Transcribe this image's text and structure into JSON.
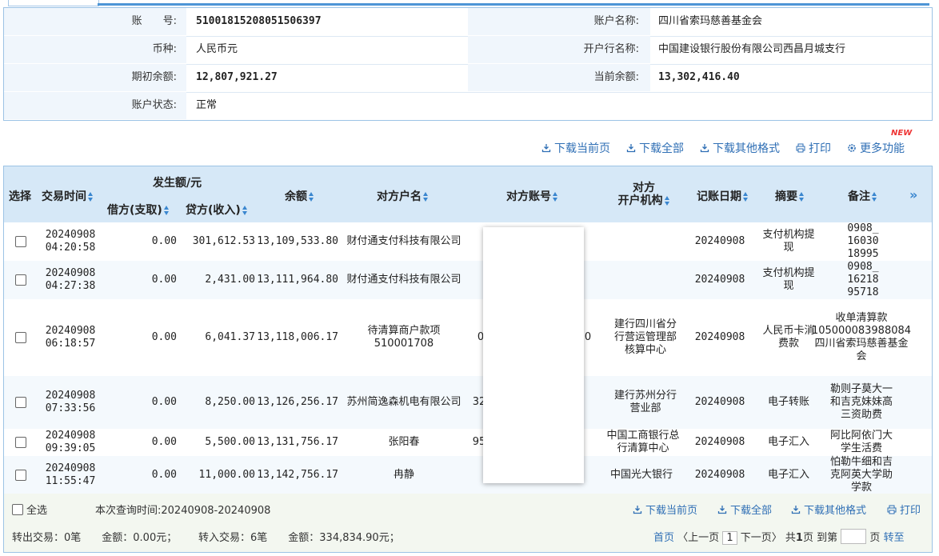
{
  "account": {
    "acct_no_label": "账　　号:",
    "acct_no": "51001815208051506397",
    "acct_name_label": "账户名称:",
    "acct_name": "四川省索玛慈善基金会",
    "currency_label": "币种:",
    "currency": "人民币元",
    "bank_label": "开户行名称:",
    "bank": "中国建设银行股份有限公司西昌月城支行",
    "opening_balance_label": "期初余额:",
    "opening_balance": "12,807,921.27",
    "current_balance_label": "当前余额:",
    "current_balance": "13,302,416.40",
    "status_label": "账户状态:",
    "status": "正常"
  },
  "toolbar": {
    "badge": "NEW",
    "items": [
      {
        "label": "下载当前页",
        "icon": "download-icon"
      },
      {
        "label": "下载全部",
        "icon": "download-icon"
      },
      {
        "label": "下载其他格式",
        "icon": "download-icon"
      },
      {
        "label": "打印",
        "icon": "print-icon"
      },
      {
        "label": "更多功能",
        "icon": "gear-icon"
      }
    ]
  },
  "table": {
    "headers": {
      "select": "选择",
      "time": "交易时间",
      "amount_group": "发生额/元",
      "debit": "借方(支取)",
      "credit": "贷方(收入)",
      "balance": "余额",
      "cp_name": "对方户名",
      "cp_acct": "对方账号",
      "cp_bank": "对方\n开户机构",
      "post_date": "记账日期",
      "summary": "摘要",
      "remark": "备注",
      "more": "»"
    },
    "rows": [
      {
        "date": "20240908",
        "time": "04:20:58",
        "debit": "0.00",
        "credit": "301,612.53",
        "balance": "13,109,533.80",
        "cp_name": "财付通支付科技有限公司",
        "cp_acct": "",
        "cp_bank": "",
        "post_date": "20240908",
        "summary": "支付机构提现",
        "remark": "0908_1603018995"
      },
      {
        "date": "20240908",
        "time": "04:27:38",
        "debit": "0.00",
        "credit": "2,431.00",
        "balance": "13,111,964.80",
        "cp_name": "财付通支付科技有限公司",
        "cp_acct": "",
        "cp_bank": "",
        "post_date": "20240908",
        "summary": "支付机构提现",
        "remark": "0908_1621895718"
      },
      {
        "date": "20240908",
        "time": "06:18:57",
        "debit": "0.00",
        "credit": "6,041.37",
        "balance": "13,118,006.17",
        "cp_name": "待清算商户款项510001708",
        "cp_acct": "0",
        "cp_acct_tail": "0",
        "cp_bank": "建行四川省分行营运管理部核算中心",
        "post_date": "20240908",
        "summary": "人民币卡消费款",
        "remark": "收单清算款105000083988084四川省索玛慈善基金会"
      },
      {
        "date": "20240908",
        "time": "07:33:56",
        "debit": "0.00",
        "credit": "8,250.00",
        "balance": "13,126,256.17",
        "cp_name": "苏州简逸森机电有限公司",
        "cp_acct": "32",
        "cp_bank": "建行苏州分行营业部",
        "post_date": "20240908",
        "summary": "电子转账",
        "remark": "勒则子莫大一和吉克妹妹高三资助费"
      },
      {
        "date": "20240908",
        "time": "09:39:05",
        "debit": "0.00",
        "credit": "5,500.00",
        "balance": "13,131,756.17",
        "cp_name": "张阳春",
        "cp_acct": "95",
        "cp_bank": "中国工商银行总行清算中心",
        "post_date": "20240908",
        "summary": "电子汇入",
        "remark": "阿比阿依门大学生活费"
      },
      {
        "date": "20240908",
        "time": "11:55:47",
        "debit": "0.00",
        "credit": "11,000.00",
        "balance": "13,142,756.17",
        "cp_name": "冉静",
        "cp_acct": "",
        "cp_bank": "中国光大银行",
        "post_date": "20240908",
        "summary": "电子汇入",
        "remark": "怕勒牛细和吉克阿英大学助学款"
      }
    ]
  },
  "footer": {
    "select_all": "全选",
    "query_time": "本次查询时间:20240908-20240908",
    "links": [
      "下载当前页",
      "下载全部",
      "下载其他格式",
      "打印"
    ],
    "out_summary": "转出交易：0笔　　金额：0.00元；",
    "in_summary": "转入交易：6笔　　金额：334,834.90元；",
    "first": "首页",
    "prev": "〈上一页",
    "page": "1",
    "next": "下一页〉",
    "total_pre": "共",
    "total": "1",
    "total_post": "页",
    "goto_pre": "到第",
    "goto_post": "页",
    "go": "转至"
  }
}
